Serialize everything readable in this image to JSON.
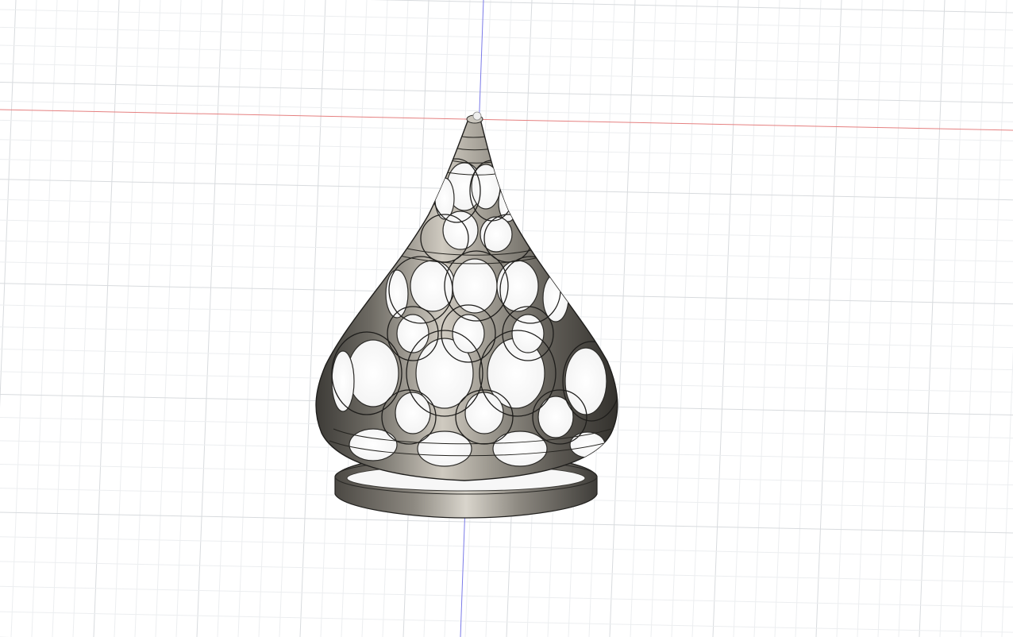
{
  "viewport": {
    "background_color": "#ffffff",
    "grid_minor_color": "#eceef0",
    "grid_major_color": "#d8dbde",
    "axis_x_color": "#e07070",
    "axis_y_color": "#7070e0"
  },
  "model": {
    "name": "lattice-cone-lampshade",
    "material_color": "#8a867e",
    "shadow_color": "#3a3834",
    "highlight_color": "#d6d2c8",
    "edge_color": "#1f1e1c"
  }
}
